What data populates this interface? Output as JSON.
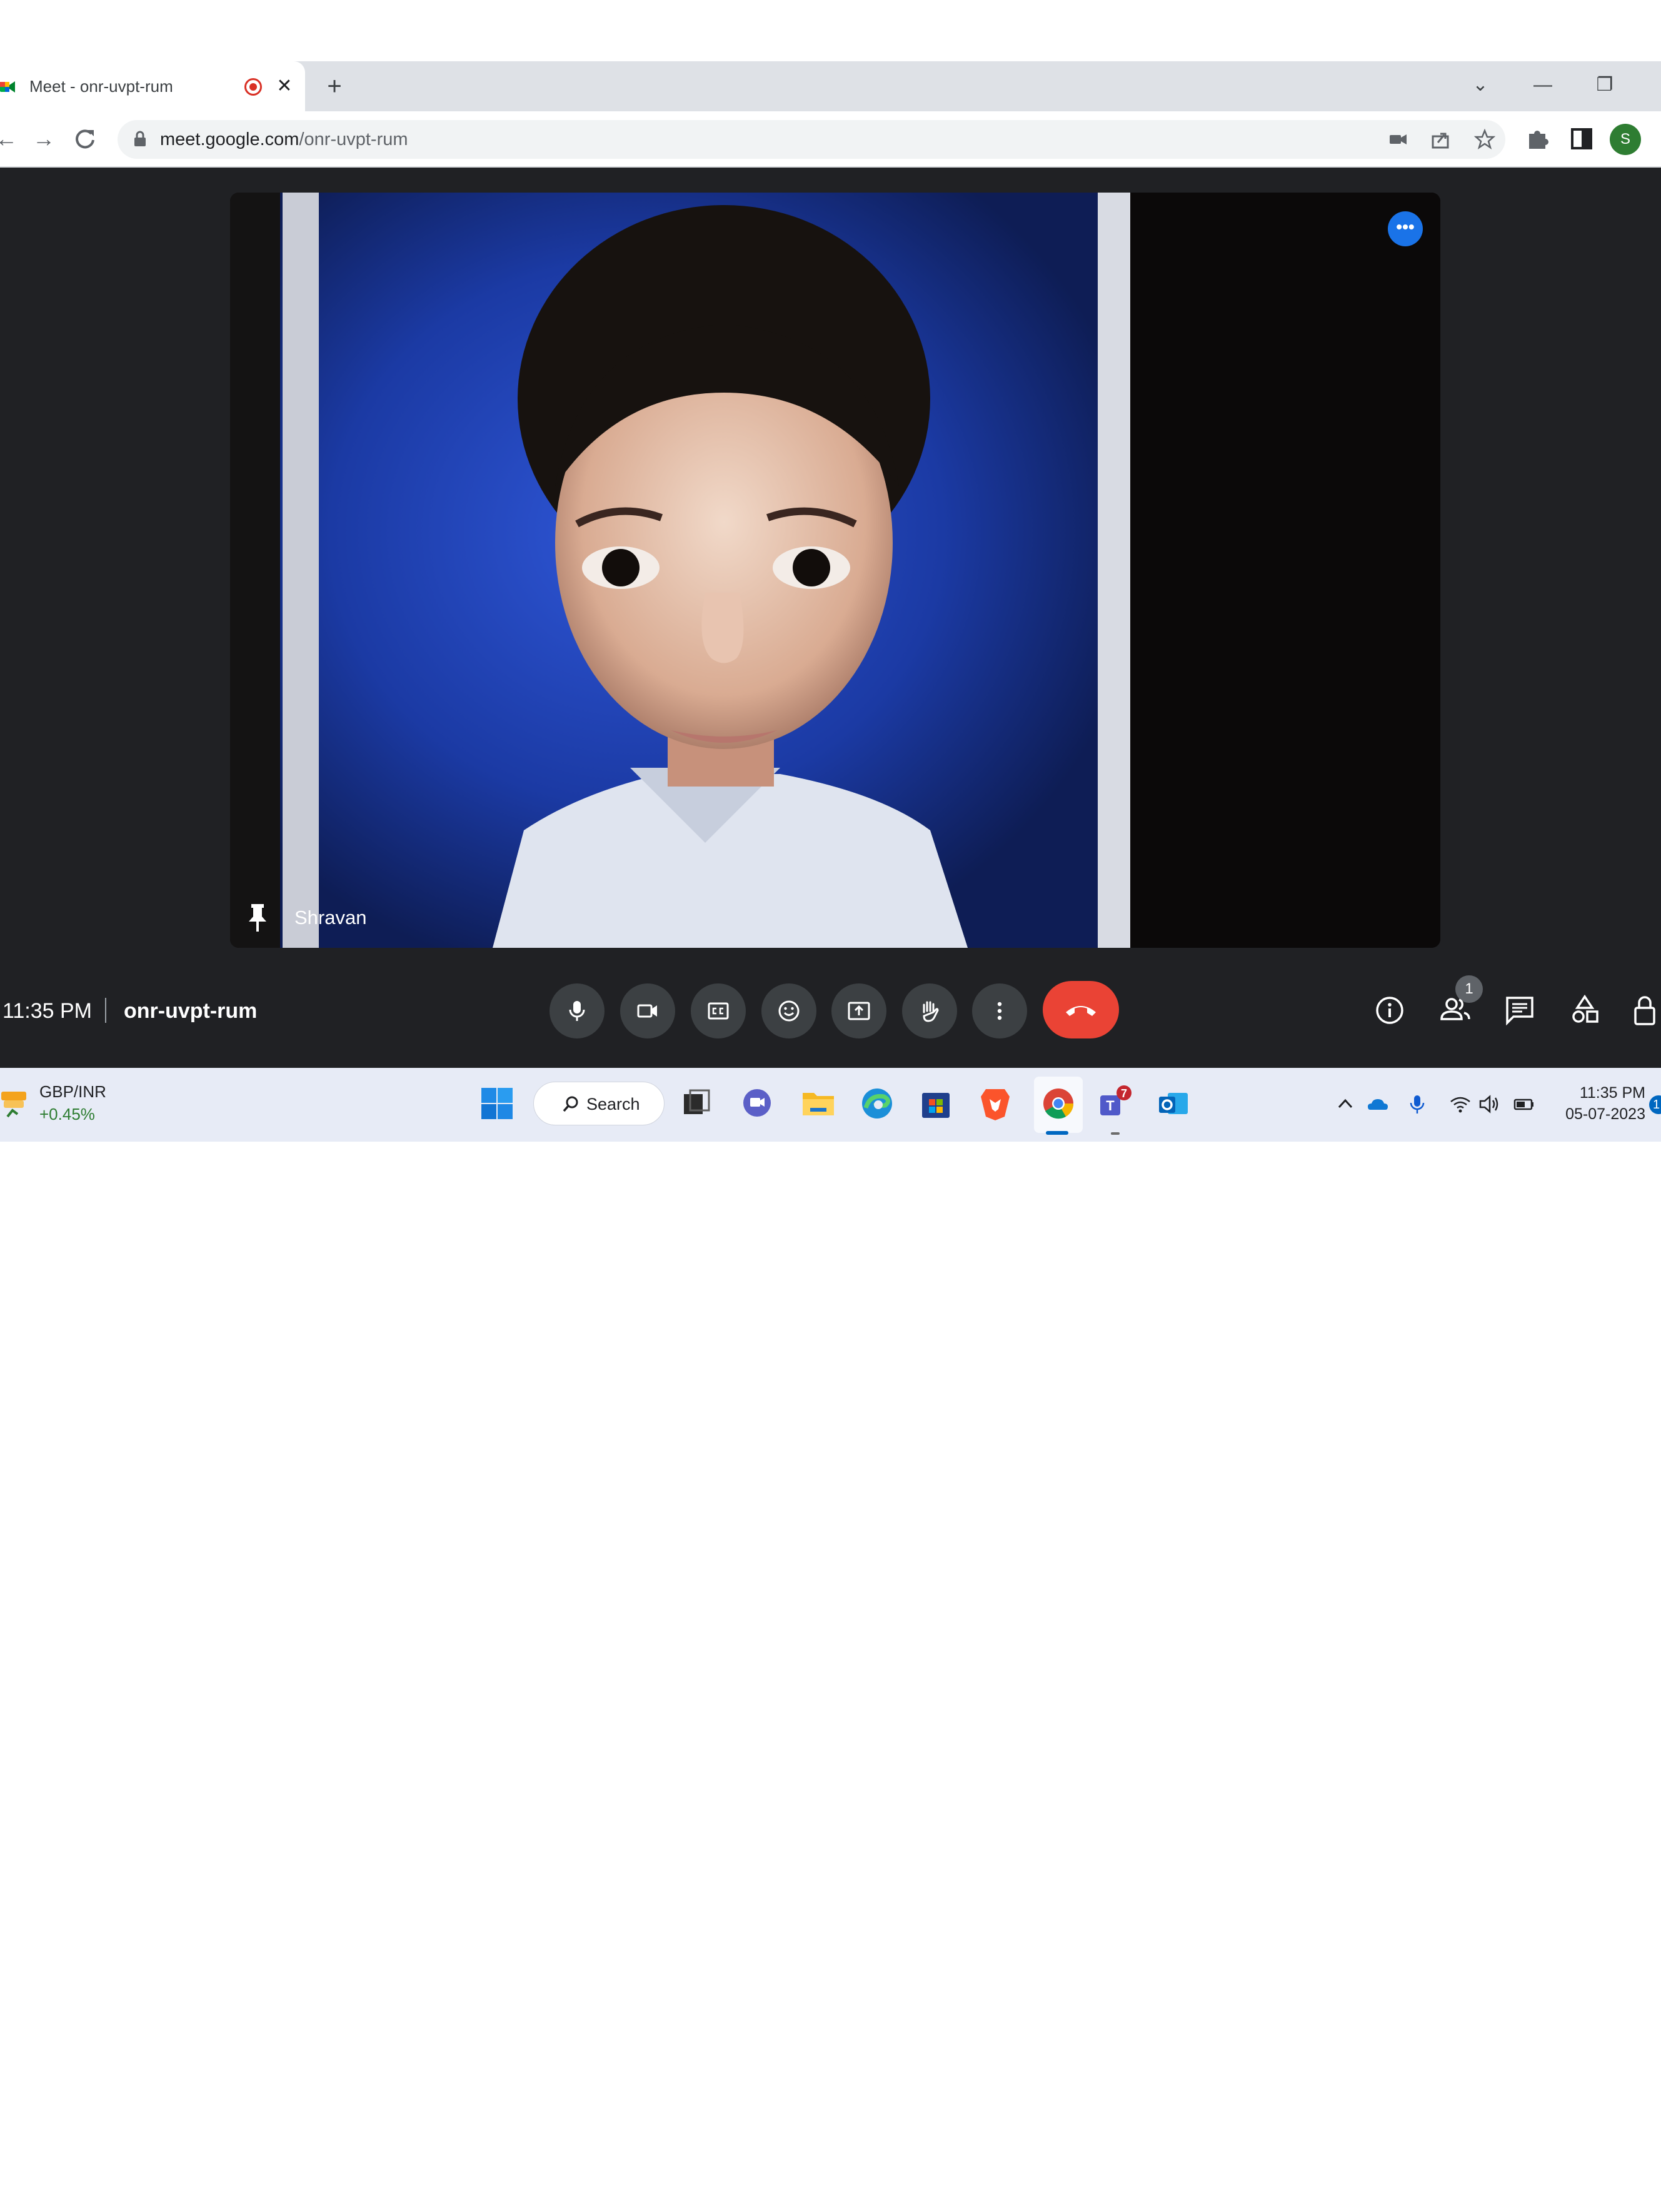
{
  "browser": {
    "tab": {
      "title": "Meet - onr-uvpt-rum",
      "close_glyph": "✕"
    },
    "new_tab_glyph": "+",
    "window_controls": [
      "⌄",
      "—",
      "❐"
    ],
    "url": {
      "host": "meet.google.com",
      "path": "/onr-uvpt-rum"
    },
    "profile_initial": "S"
  },
  "meet": {
    "participant_name": "Shravan",
    "options_glyph": "•••",
    "time": "11:35 PM",
    "meeting_code": "onr-uvpt-rum",
    "participant_count": "1",
    "colors": {
      "background": "#202124",
      "control": "#3c4043",
      "leave": "#ea4335",
      "accent": "#1a73e8"
    }
  },
  "taskbar": {
    "widget": {
      "name": "GBP/INR",
      "value": "+0.45%"
    },
    "search_label": "Search",
    "apps": [
      "start",
      "search",
      "task-view",
      "teams-chat",
      "file-explorer",
      "edge",
      "microsoft-store",
      "brave",
      "chrome",
      "teams",
      "outlook"
    ],
    "teams_badge": "7",
    "clock": {
      "time": "11:35 PM",
      "date": "05-07-2023"
    },
    "notification_count": "1"
  }
}
